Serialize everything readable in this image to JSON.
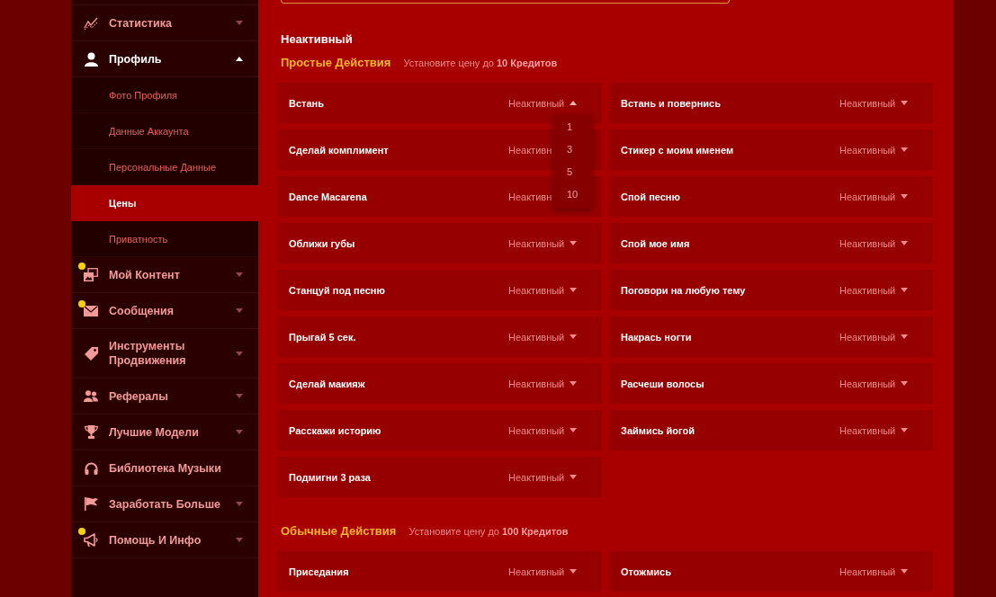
{
  "sidebar": {
    "items": [
      {
        "label": "Статистика",
        "kind": "group",
        "expanded": false,
        "dot": false
      },
      {
        "label": "Профиль",
        "kind": "group",
        "expanded": true,
        "dot": false,
        "children": [
          {
            "label": "Фото Профиля",
            "selected": false
          },
          {
            "label": "Данные Аккаунта",
            "selected": false
          },
          {
            "label": "Персональные Данные",
            "selected": false
          },
          {
            "label": "Цены",
            "selected": true
          },
          {
            "label": "Приватность",
            "selected": false
          }
        ]
      },
      {
        "label": "Мой Контент",
        "kind": "group",
        "expanded": false,
        "dot": true
      },
      {
        "label": "Сообщения",
        "kind": "group",
        "expanded": false,
        "dot": true
      },
      {
        "label": "Инструменты Продвижения",
        "kind": "group",
        "expanded": false,
        "dot": false
      },
      {
        "label": "Рефералы",
        "kind": "group",
        "expanded": false,
        "dot": false
      },
      {
        "label": "Лучшие Модели",
        "kind": "group",
        "expanded": false,
        "dot": false
      },
      {
        "label": "Библиотека Музыки",
        "kind": "link",
        "dot": false
      },
      {
        "label": "Заработать Больше",
        "kind": "group",
        "expanded": false,
        "dot": false
      },
      {
        "label": "Помощь И Инфо",
        "kind": "group",
        "expanded": false,
        "dot": true
      }
    ]
  },
  "content": {
    "heading": "Неактивный",
    "sections": [
      {
        "title": "Простые Действия",
        "hint": "Установите цену до **10 Кредитов**",
        "cards": [
          {
            "title": "Встань",
            "status": "Неактивный",
            "expanded": true,
            "covered": false,
            "options": [
              {
                "label": "1",
                "selected": false
              },
              {
                "label": "3",
                "selected": false
              },
              {
                "label": "5",
                "selected": false
              },
              {
                "label": "10",
                "selected": false
              }
            ]
          },
          {
            "title": "Встань и повернись",
            "status": "Неактивный",
            "expanded": false,
            "covered": false
          },
          {
            "title": "Сделай комплимент",
            "status": "Неактивн",
            "expanded": false,
            "covered": true
          },
          {
            "title": "Стикер с моим именем",
            "status": "Неактивный",
            "expanded": false,
            "covered": false
          },
          {
            "title": "Dance Macarena",
            "status": "Неактивн",
            "expanded": false,
            "covered": true
          },
          {
            "title": "Спой песню",
            "status": "Неактивный",
            "expanded": false,
            "covered": false
          },
          {
            "title": "Оближи губы",
            "status": "Неактивный",
            "expanded": false,
            "covered": false
          },
          {
            "title": "Спой мое имя",
            "status": "Неактивный",
            "expanded": false,
            "covered": false
          },
          {
            "title": "Станцуй под песню",
            "status": "Неактивный",
            "expanded": false,
            "covered": false
          },
          {
            "title": "Поговори на любую тему",
            "status": "Неактивный",
            "expanded": false,
            "covered": false
          },
          {
            "title": "Прыгай 5 сек.",
            "status": "Неактивный",
            "expanded": false,
            "covered": false
          },
          {
            "title": "Накрась ногти",
            "status": "Неактивный",
            "expanded": false,
            "covered": false
          },
          {
            "title": "Сделай макияж",
            "status": "Неактивный",
            "expanded": false,
            "covered": false
          },
          {
            "title": "Расчеши волосы",
            "status": "Неактивный",
            "expanded": false,
            "covered": false
          },
          {
            "title": "Расскажи историю",
            "status": "Неактивный",
            "expanded": false,
            "covered": false
          },
          {
            "title": "Займись йогой",
            "status": "Неактивный",
            "expanded": false,
            "covered": false
          },
          {
            "title": "Подмигни 3 раза",
            "status": "Неактивный",
            "expanded": false,
            "covered": false
          }
        ]
      },
      {
        "title": "Обычные Действия",
        "hint": "Установите цену до **100 Кредитов**",
        "cards": [
          {
            "title": "Приседания",
            "status": "Неактивный",
            "expanded": false,
            "covered": false
          },
          {
            "title": "Отожмись",
            "status": "Неактивный",
            "expanded": false,
            "covered": false
          }
        ]
      }
    ]
  }
}
